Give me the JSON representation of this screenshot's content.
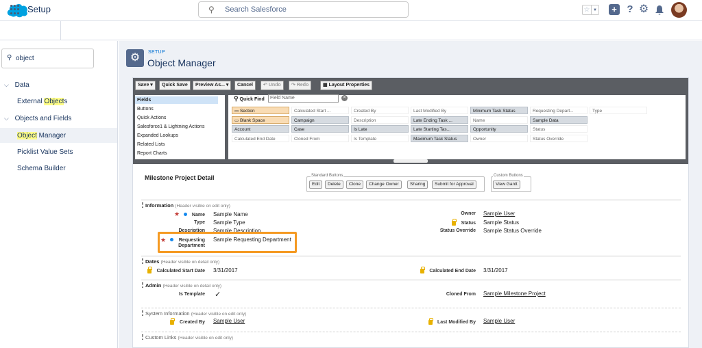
{
  "header": {
    "search_placeholder": "Search Salesforce",
    "icons": [
      "salesforce-logo",
      "star-icon",
      "chevron-down-icon",
      "plus-icon",
      "help-icon",
      "gear-icon",
      "bell-icon",
      "avatar"
    ]
  },
  "setup_bar": {
    "title": "Setup"
  },
  "sidebar": {
    "quick_find_value": "object",
    "groups": [
      {
        "label": "Data",
        "items": [
          {
            "pre": "External ",
            "hl": "Object",
            "post": "s"
          }
        ]
      },
      {
        "label": "Objects and Fields",
        "items": [
          {
            "pre": "",
            "hl": "Object",
            "post": " Manager",
            "selected": true
          },
          {
            "pre": "Picklist Value Sets",
            "hl": "",
            "post": ""
          },
          {
            "pre": "Schema Builder",
            "hl": "",
            "post": ""
          }
        ]
      }
    ]
  },
  "page": {
    "breadcrumb": "SETUP",
    "title": "Object Manager"
  },
  "palette": {
    "toolbar": [
      "Save",
      "Quick Save",
      "Preview As...",
      "Cancel",
      "Undo",
      "Redo",
      "Layout Properties"
    ],
    "categories": [
      "Fields",
      "Buttons",
      "Quick Actions",
      "Salesforce1 & Lightning Actions",
      "Expanded Lookups",
      "Related Lists",
      "Report Charts"
    ],
    "quick_find_label": "Quick Find",
    "quick_find_placeholder": "Field Name",
    "fields": [
      [
        "Section",
        "Calculated Start ...",
        "Created By",
        "Last Modified By",
        "Minimum Task Status",
        "Requesting Depart...",
        "Type"
      ],
      [
        "Blank Space",
        "Campaign",
        "Description",
        "Late Ending Task ...",
        "Name",
        "Sample Data",
        ""
      ],
      [
        "Account",
        "Case",
        "Is Late",
        "Late Starting Tas...",
        "Opportunity",
        "Status",
        ""
      ],
      [
        "Calculated End Date",
        "Cloned From",
        "Is Template",
        "Maximum Task Status",
        "Owner",
        "Status Override",
        ""
      ]
    ]
  },
  "layout": {
    "detail_title": "Milestone Project Detail",
    "standard_buttons_label": "Standard Buttons",
    "custom_buttons_label": "Custom Buttons",
    "standard_buttons": [
      "Edit",
      "Delete",
      "Clone",
      "Change Owner",
      "Sharing",
      "Submit for Approval"
    ],
    "custom_buttons": [
      "View Gantt"
    ],
    "sections": {
      "information": {
        "title": "Information",
        "note": "(Header visible on edit only)"
      },
      "dates": {
        "title": "Dates",
        "note": "(Header visible on detail only)"
      },
      "admin": {
        "title": "Admin",
        "note": "(Header visible on detail only)"
      },
      "system": {
        "title": "System Information",
        "note": "(Header visible on edit only)"
      },
      "links": {
        "title": "Custom Links",
        "note": "(Header visible on edit only)"
      }
    },
    "fields": {
      "name_label": "Name",
      "name_value": "Sample Name",
      "type_label": "Type",
      "type_value": "Sample Type",
      "desc_label": "Description",
      "desc_value": "Sample Description",
      "req_label_1": "Requesting",
      "req_label_2": "Department",
      "req_value": "Sample Requesting Department",
      "owner_label": "Owner",
      "owner_value": "Sample User",
      "status_label": "Status",
      "status_value": "Sample Status",
      "status_override_label": "Status Override",
      "status_override_value": "Sample Status Override",
      "calc_start_label": "Calculated Start Date",
      "calc_start_value": "3/31/2017",
      "calc_end_label": "Calculated End Date",
      "calc_end_value": "3/31/2017",
      "is_template_label": "Is Template",
      "is_template_value": "✓",
      "cloned_from_label": "Cloned From",
      "cloned_from_value": "Sample Milestone Project",
      "created_by_label": "Created By",
      "created_by_value": "Sample User",
      "last_modified_label": "Last Modified By",
      "last_modified_value": "Sample User"
    }
  },
  "colors": {
    "brand": "#00a1e0",
    "highlight_border": "#f59a23",
    "search_hl": "#fffd87"
  }
}
